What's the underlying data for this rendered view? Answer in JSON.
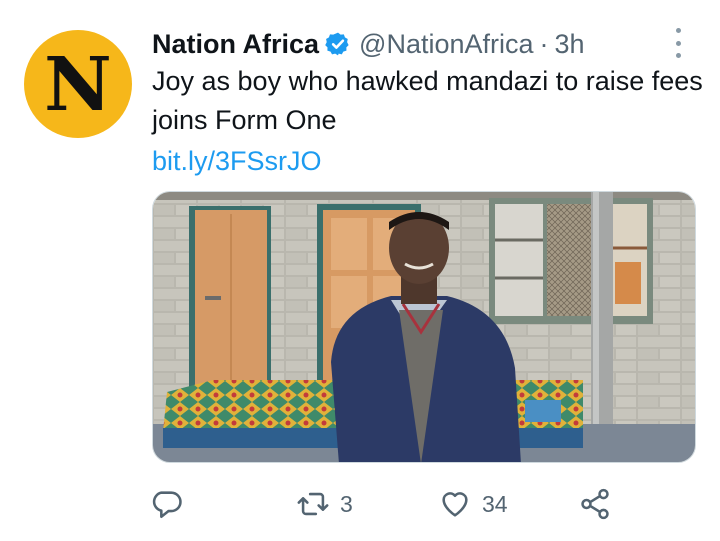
{
  "tweet": {
    "author_name": "Nation Africa",
    "handle": "@NationAfrica",
    "separator": "·",
    "time": "3h",
    "avatar_letter": "N",
    "avatar_color": "#f6b71a",
    "text": "Joy as boy who hawked mandazi to raise fees joins Form One",
    "link": "bit.ly/3FSsrJO",
    "verified_icon": "verified-badge-icon",
    "accent_color": "#1d9bf0"
  },
  "actions": {
    "reply": {
      "icon": "reply-icon",
      "count": ""
    },
    "retweet": {
      "icon": "retweet-icon",
      "count": "3"
    },
    "like": {
      "icon": "heart-icon",
      "count": "34"
    },
    "share": {
      "icon": "share-icon"
    }
  }
}
